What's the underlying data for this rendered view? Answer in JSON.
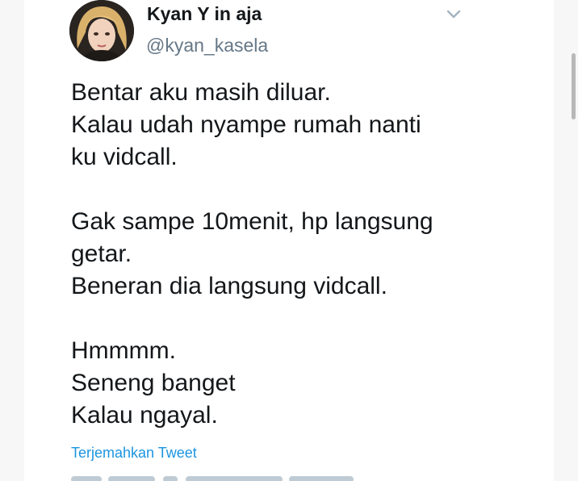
{
  "tweet": {
    "author": {
      "display_name": "Kyan Y in aja",
      "handle": "@kyan_kasela"
    },
    "paragraphs": [
      [
        "Bentar aku masih diluar.",
        "Kalau udah nyampe rumah nanti",
        "ku vidcall."
      ],
      [
        "Gak sampe 10menit, hp langsung",
        "getar.",
        "Beneran dia langsung vidcall."
      ],
      [
        "Hmmmm.",
        "Seneng banget",
        "Kalau ngayal."
      ]
    ],
    "translate_label": "Terjemahkan Tweet",
    "menu_icon": "chevron-down-icon"
  },
  "colors": {
    "text": "#14171a",
    "secondary": "#657786",
    "link": "#1b95e0",
    "background": "#ffffff"
  }
}
